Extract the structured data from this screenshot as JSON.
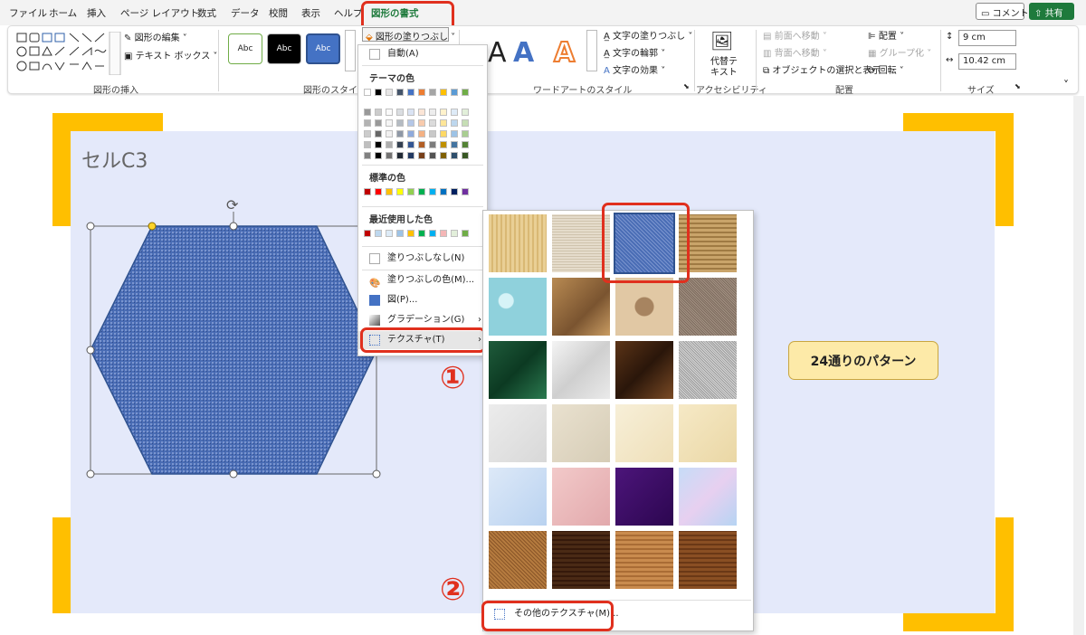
{
  "tabs": [
    "ファイル",
    "ホーム",
    "挿入",
    "ページ レイアウト",
    "数式",
    "データ",
    "校閲",
    "表示",
    "ヘルプ",
    "図形の書式"
  ],
  "top_right": {
    "comment": "コメント",
    "share": "共有"
  },
  "ribbon": {
    "insert_shapes": {
      "edit_shape": "図形の編集",
      "text_box": "テキスト ボックス",
      "group": "図形の挿入"
    },
    "shape_styles": {
      "samples": [
        "Abc",
        "Abc",
        "Abc"
      ],
      "fill_button": "図形の塗りつぶし",
      "group": "図形のスタイル"
    },
    "wordart": {
      "text_fill": "文字の塗りつぶし",
      "text_outline": "文字の輪郭",
      "text_effects": "文字の効果",
      "group": "ワードアートのスタイル",
      "letter": "A"
    },
    "accessibility": {
      "alt_text_l1": "代替テ",
      "alt_text_l2": "キスト",
      "group": "アクセシビリティ"
    },
    "arrange": {
      "bring_forward": "前面へ移動",
      "send_backward": "背面へ移動",
      "selection_pane": "オブジェクトの選択と表示",
      "align": "配置",
      "group_btn": "グループ化",
      "rotate": "回転",
      "group": "配置"
    },
    "size": {
      "height": "9 cm",
      "width": "10.42 cm",
      "group": "サイズ"
    }
  },
  "sheet": {
    "cell_label": "セルC3",
    "pattern_label": "24通りのパターン"
  },
  "fill_menu": {
    "auto": "自動(A)",
    "theme_colors": "テーマの色",
    "standard_colors": "標準の色",
    "recent_colors": "最近使用した色",
    "no_fill": "塗りつぶしなし(N)",
    "more_colors": "塗りつぶしの色(M)...",
    "picture": "図(P)...",
    "gradient": "グラデーション(G)",
    "texture": "テクスチャ(T)"
  },
  "colors": {
    "theme_top": [
      "#ffffff",
      "#000000",
      "#e7e6e6",
      "#44546a",
      "#4472c4",
      "#ed7d31",
      "#a5a5a5",
      "#ffc000",
      "#5b9bd5",
      "#70ad47"
    ],
    "standard": [
      "#c00000",
      "#ff0000",
      "#ffc000",
      "#ffff00",
      "#92d050",
      "#00b050",
      "#00b0f0",
      "#0070c0",
      "#002060",
      "#7030a0"
    ],
    "recent": [
      "#c00000",
      "#bdd7ee",
      "#ddebf7",
      "#9dc3e6",
      "#ffc000",
      "#00b050",
      "#00b0f0",
      "#f4b6b6",
      "#e2efda",
      "#70ad47"
    ],
    "accent": "#1e7a3c",
    "highlight": "#e0301e",
    "canvas": "#e4e9fa",
    "corner": "#ffbf00"
  },
  "texture_menu": {
    "more": "その他のテクスチャ(M)...",
    "textures": [
      "papyrus",
      "canvas",
      "denim",
      "woven-mat",
      "water-droplets",
      "paper-bag",
      "fish-fossil",
      "sand",
      "green-marble",
      "white-marble",
      "brown-marble",
      "granite",
      "newsprint",
      "recycled-paper",
      "parchment",
      "stationery",
      "blue-tissue-paper",
      "pink-tissue-paper",
      "purple-mesh",
      "bouquet",
      "cork",
      "walnut",
      "oak",
      "medium-wood"
    ],
    "selected": "denim"
  },
  "annotations": {
    "step1": "①",
    "step2": "②"
  }
}
